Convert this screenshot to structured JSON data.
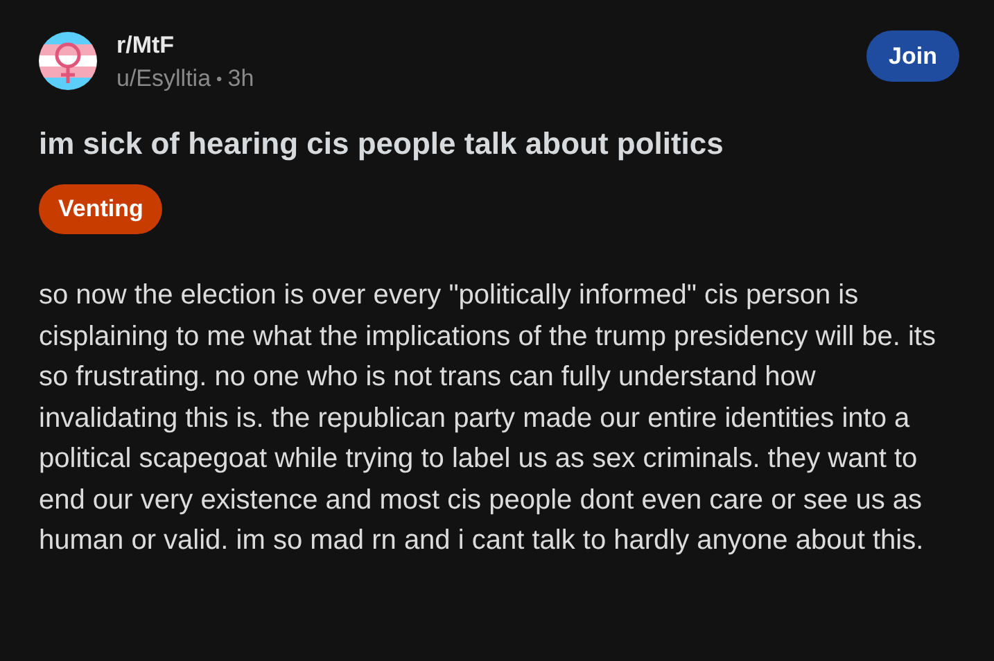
{
  "post": {
    "subreddit": "r/MtF",
    "author": "u/Esylltia",
    "separator": "•",
    "age": "3h",
    "join_label": "Join",
    "title": "im sick of hearing cis people talk about politics",
    "flair": "Venting",
    "body": "so now the election is over every \"politically informed\" cis person is cisplaining to me what the implications of the trump presidency will be. its so frustrating. no one who is not trans can fully understand how invalidating this is. the republican party made our entire identities into a political scapegoat while trying to label us as sex criminals. they want to end our very existence and most cis people dont even care or see us as human or valid. im so mad rn and i cant talk to hardly anyone about this."
  }
}
